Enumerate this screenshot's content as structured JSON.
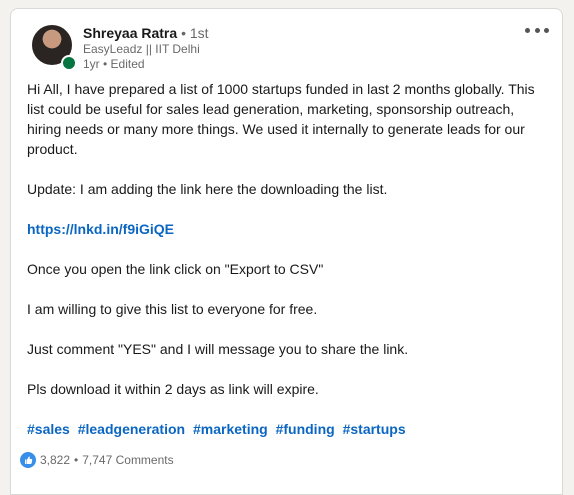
{
  "post": {
    "author": {
      "name": "Shreyaa Ratra",
      "connection": "• 1st",
      "headline": "EasyLeadz || IIT Delhi",
      "meta": "1yr • Edited"
    },
    "paragraphs": [
      "Hi All, I have prepared a list of 1000 startups funded in last 2 months globally. This list could be useful for sales lead generation, marketing, sponsorship outreach, hiring needs or many more things. We used it internally to generate leads for our product.",
      "Update: I am adding the link here the downloading the list."
    ],
    "link": "https://lnkd.in/f9iGiQE",
    "paragraphs_after": [
      "Once you open the link click on \"Export to CSV\"",
      "I am willing to give this list to everyone for free.",
      "Just comment \"YES\" and I will message you to share the link.",
      "Pls download it within 2 days as link will expire."
    ],
    "hashtags": [
      "#sales",
      "#leadgeneration",
      "#marketing",
      "#funding",
      "#startups"
    ],
    "reactions_count": "3,822",
    "separator": "•",
    "comments_label": "7,747 Comments"
  },
  "colors": {
    "link": "#0a66c2",
    "presence": "#057642",
    "like": "#378fe9"
  },
  "icons": {
    "more": "ellipsis-icon",
    "like": "thumbs-up-icon"
  }
}
